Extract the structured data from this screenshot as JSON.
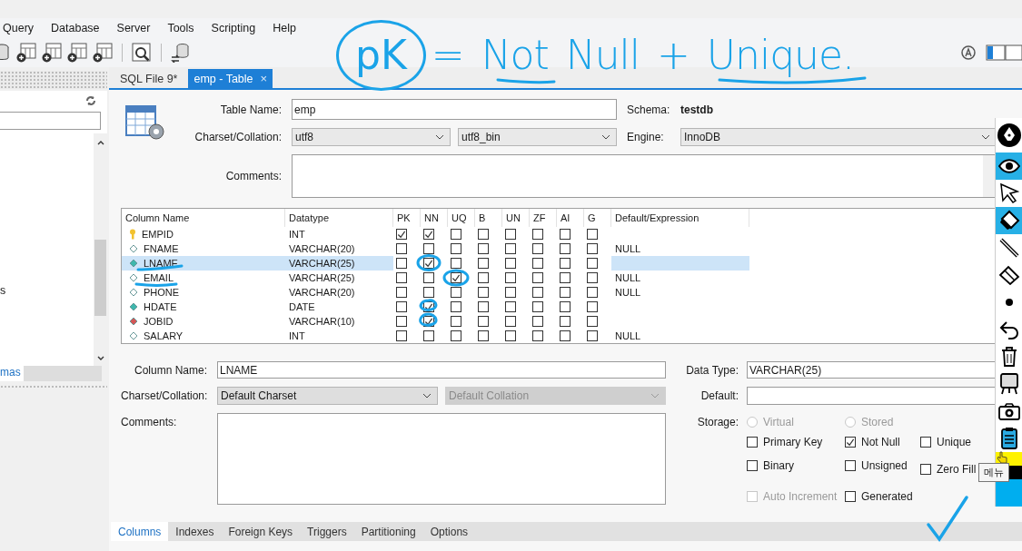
{
  "menu": [
    {
      "label": "Query"
    },
    {
      "label": "Database"
    },
    {
      "label": "Server"
    },
    {
      "label": "Tools"
    },
    {
      "label": "Scripting"
    },
    {
      "label": "Help"
    }
  ],
  "sidebar": {
    "items": [
      {
        "label": "s"
      }
    ],
    "tab": {
      "label": "mas",
      "selected": true
    }
  },
  "tabs": [
    {
      "label": "SQL File 9*",
      "selected": false
    },
    {
      "label": "emp - Table",
      "selected": true,
      "close": "×"
    }
  ],
  "table_editor": {
    "table_name_label": "Table Name:",
    "table_name": "emp",
    "schema_label": "Schema:",
    "schema": "testdb",
    "charset_label": "Charset/Collation:",
    "charset": "utf8",
    "collation": "utf8_bin",
    "engine_label": "Engine:",
    "engine": "InnoDB",
    "comments_label": "Comments:"
  },
  "columns_grid": {
    "headers": [
      "Column Name",
      "Datatype",
      "PK",
      "NN",
      "UQ",
      "B",
      "UN",
      "ZF",
      "AI",
      "G",
      "Default/Expression"
    ],
    "rows": [
      {
        "kind": "primary",
        "name": "EMPID",
        "datatype": "INT",
        "flags": [
          true,
          true,
          false,
          false,
          false,
          false,
          false,
          false
        ],
        "selected": false
      },
      {
        "kind": "nullable",
        "name": "FNAME",
        "datatype": "VARCHAR(20)",
        "flags": [
          false,
          false,
          false,
          false,
          false,
          false,
          false,
          false
        ],
        "default": "NULL",
        "selected": false
      },
      {
        "kind": "not_null",
        "name": "LNAME",
        "datatype": "VARCHAR(25)",
        "flags": [
          false,
          true,
          false,
          false,
          false,
          false,
          false,
          false
        ],
        "selected": true
      },
      {
        "kind": "nullable",
        "name": "EMAIL",
        "datatype": "VARCHAR(25)",
        "flags": [
          false,
          false,
          true,
          false,
          false,
          false,
          false,
          false
        ],
        "default": "NULL",
        "selected": false
      },
      {
        "kind": "nullable",
        "name": "PHONE",
        "datatype": "VARCHAR(20)",
        "flags": [
          false,
          false,
          false,
          false,
          false,
          false,
          false,
          false
        ],
        "default": "NULL",
        "selected": false
      },
      {
        "kind": "not_null",
        "name": "HDATE",
        "datatype": "DATE",
        "flags": [
          false,
          true,
          false,
          false,
          false,
          false,
          false,
          false
        ],
        "selected": false
      },
      {
        "kind": "foreign",
        "name": "JOBID",
        "datatype": "VARCHAR(10)",
        "flags": [
          false,
          true,
          false,
          false,
          false,
          false,
          false,
          false
        ],
        "selected": false
      },
      {
        "kind": "nullable",
        "name": "SALARY",
        "datatype": "INT",
        "flags": [
          false,
          false,
          false,
          false,
          false,
          false,
          false,
          false
        ],
        "default": "NULL",
        "selected": false
      }
    ]
  },
  "column_details": {
    "name_label": "Column Name:",
    "name": "LNAME",
    "charset_label": "Charset/Collation:",
    "charset": "Default Charset",
    "collation": "Default Collation",
    "collation_disabled": true,
    "comments_label": "Comments:",
    "datatype_label": "Data Type:",
    "datatype": "VARCHAR(25)",
    "default_label": "Default:",
    "storage_label": "Storage:",
    "storage_options": [
      {
        "label": "Virtual",
        "selected": false,
        "disabled": true
      },
      {
        "label": "Stored",
        "selected": false,
        "disabled": true
      }
    ],
    "options": [
      {
        "label": "Primary Key",
        "checked": false,
        "disabled": false
      },
      {
        "label": "Not Null",
        "checked": true,
        "disabled": false
      },
      {
        "label": "Unique",
        "checked": false,
        "disabled": false
      },
      {
        "label": "Binary",
        "checked": false,
        "disabled": false
      },
      {
        "label": "Unsigned",
        "checked": false,
        "disabled": false
      },
      {
        "label": "Zero Fill",
        "checked": false,
        "disabled": false
      },
      {
        "label": "Auto Increment",
        "checked": false,
        "disabled": true
      },
      {
        "label": "Generated",
        "checked": false,
        "disabled": false
      }
    ]
  },
  "bottom_tabs": [
    {
      "label": "Columns",
      "selected": true
    },
    {
      "label": "Indexes",
      "selected": false
    },
    {
      "label": "Foreign Keys",
      "selected": false
    },
    {
      "label": "Triggers",
      "selected": false
    },
    {
      "label": "Partitioning",
      "selected": false
    },
    {
      "label": "Options",
      "selected": false
    }
  ],
  "annotation": {
    "circled": "pK",
    "text": "= Not Null + Unique."
  },
  "drawing_toolbar": {
    "tools": [
      {
        "kind": "pen",
        "selected": false
      },
      {
        "kind": "eye",
        "selected": true
      },
      {
        "kind": "pointer",
        "selected": false
      },
      {
        "kind": "highlighter",
        "selected": true
      },
      {
        "kind": "line",
        "selected": false
      },
      {
        "kind": "eraser",
        "selected": false
      },
      {
        "kind": "dot",
        "selected": false
      },
      {
        "kind": "undo",
        "selected": false
      },
      {
        "kind": "trash",
        "selected": false
      },
      {
        "kind": "easel",
        "selected": false
      },
      {
        "kind": "camera",
        "selected": false
      },
      {
        "kind": "clipboard",
        "selected": false
      }
    ],
    "palette": [
      {
        "color": "#fff200"
      },
      {
        "color": "#000000"
      },
      {
        "color": "#00aeef"
      }
    ],
    "tooltip": "메뉴"
  }
}
